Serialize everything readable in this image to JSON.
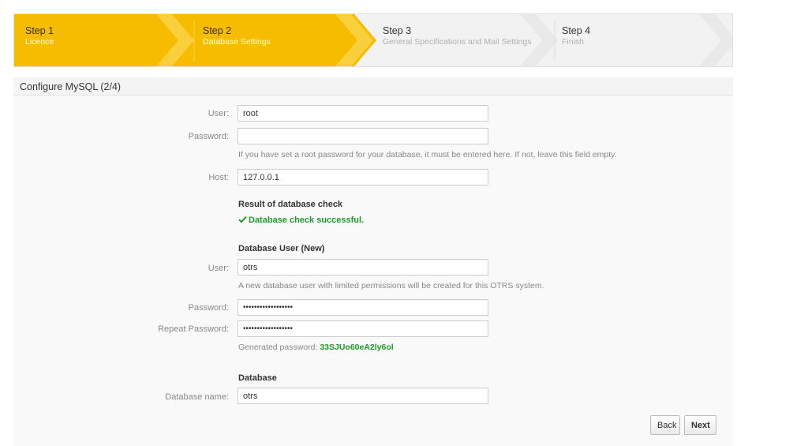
{
  "steps": [
    {
      "number": "Step 1",
      "label": "Licence"
    },
    {
      "number": "Step 2",
      "label": "Database Settings"
    },
    {
      "number": "Step 3",
      "label": "General Specifications and Mail Settings"
    },
    {
      "number": "Step 4",
      "label": "Finish"
    }
  ],
  "colors": {
    "active_step": "#f6bd00",
    "inactive_step": "#f2f2f2",
    "success": "#1c9a2a"
  },
  "panel": {
    "title": "Configure MySQL (2/4)"
  },
  "root": {
    "user_label": "User:",
    "user_value": "root",
    "password_label": "Password:",
    "password_value": "",
    "password_hint": "If you have set a root password for your database, it must be entered here. If not, leave this field empty.",
    "host_label": "Host:",
    "host_value": "127.0.0.1"
  },
  "check": {
    "heading": "Result of database check",
    "icon": "check-icon",
    "result": "Database check successful."
  },
  "db_user": {
    "heading": "Database User (New)",
    "user_label": "User:",
    "user_value": "otrs",
    "user_hint": "A new database user with limited permissions will be created for this OTRS system.",
    "password_label": "Password:",
    "password_value": "••••••••••••••••••",
    "repeat_label": "Repeat Password:",
    "repeat_value": "••••••••••••••••••",
    "generated_label": "Generated password:",
    "generated_value": "33SJUo60eA2ly6ol"
  },
  "database": {
    "heading": "Database",
    "name_label": "Database name:",
    "name_value": "otrs"
  },
  "buttons": {
    "back": "Back",
    "next": "Next"
  }
}
